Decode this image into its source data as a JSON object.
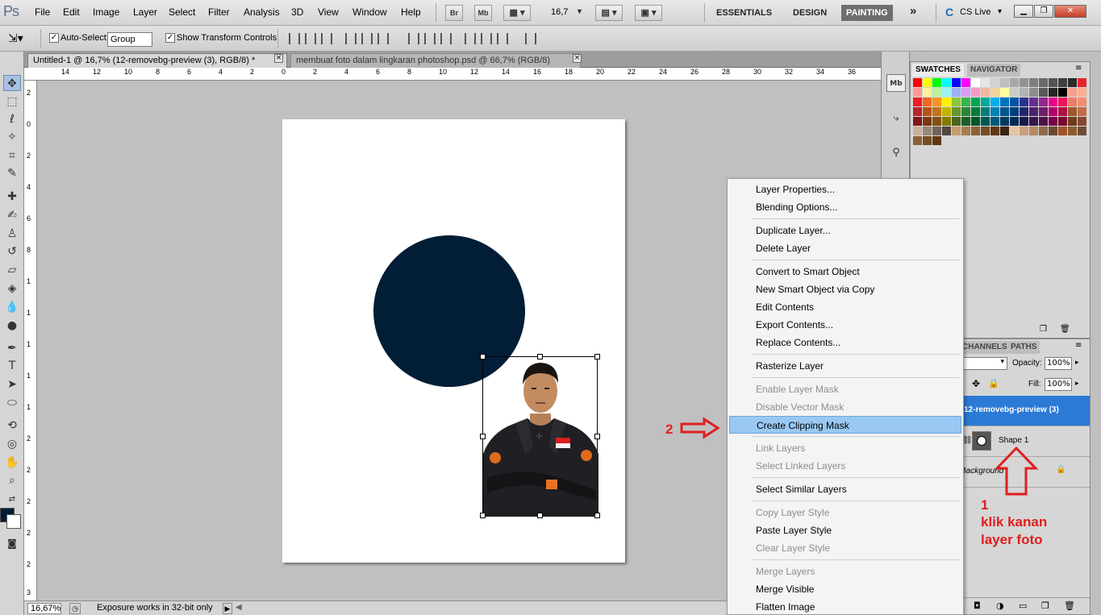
{
  "app": {
    "logo": "Ps"
  },
  "menu": {
    "items": [
      "File",
      "Edit",
      "Image",
      "Layer",
      "Select",
      "Filter",
      "Analysis",
      "3D",
      "View",
      "Window",
      "Help"
    ]
  },
  "app_bar": {
    "bridge": "Br",
    "minibridge": "Mb",
    "zoom": "16,7",
    "workspaces": [
      "ESSENTIALS",
      "DESIGN",
      "PAINTING"
    ],
    "more": "»",
    "cs_live": "CS Live"
  },
  "options": {
    "auto_select_label": "Auto-Select:",
    "auto_select_value": "Group",
    "show_transform_label": "Show Transform Controls",
    "check": "✓"
  },
  "tabs": [
    {
      "label": "Untitled-1 @ 16,7% (12-removebg-preview (3), RGB/8) *",
      "close": "×"
    },
    {
      "label": "membuat foto dalam lingkaran photoshop.psd @ 66,7% (RGB/8)",
      "close": "×"
    }
  ],
  "ruler_h": [
    "14",
    "12",
    "10",
    "8",
    "6",
    "4",
    "2",
    "0",
    "2",
    "4",
    "6",
    "8",
    "10",
    "12",
    "14",
    "16",
    "18",
    "20",
    "22",
    "24",
    "26",
    "28",
    "30",
    "32",
    "34",
    "36"
  ],
  "ruler_v": [
    "2",
    "0",
    "2",
    "4",
    "6",
    "8",
    "1",
    "1",
    "1",
    "1",
    "1",
    "2",
    "2",
    "2",
    "2",
    "2",
    "3"
  ],
  "status": {
    "zoom": "16,67%",
    "info": "Exposure works in 32-bit only"
  },
  "panels": {
    "top_tabs": [
      "SWATCHES",
      "NAVIGATOR"
    ],
    "layer_tabs": [
      "CHANNELS",
      "PATHS"
    ],
    "opacity_label": "Opacity:",
    "opacity_value": "100%",
    "fill_label": "Fill:",
    "fill_value": "100%",
    "layers": [
      {
        "name": "12-removebg-preview (3)"
      },
      {
        "name": "Shape 1"
      },
      {
        "name": "Background"
      }
    ]
  },
  "swatch_colors": [
    [
      "#ff0000",
      "#ffff00",
      "#00ff00",
      "#00ffff",
      "#0000ff",
      "#ff00ff",
      "#ffffff",
      "#e6e6e6",
      "#d2d2d2",
      "#bdbdbd",
      "#a8a8a8",
      "#939393",
      "#7e7e7e",
      "#696969",
      "#545454",
      "#3f3f3f",
      "#2a2a2a",
      "#e8232d"
    ],
    [
      "#ff9999",
      "#f6f29c",
      "#b8f29c",
      "#9cf2f2",
      "#9cb0f2",
      "#d99cf2",
      "#f29cc8",
      "#f2b89c",
      "#f2d39c",
      "#ffff99",
      "#cccccc",
      "#b3b3b3",
      "#8c8c8c",
      "#595959",
      "#262626",
      "#000000",
      "#f5a08c",
      "#f7b08f"
    ],
    [
      "#ed1c24",
      "#f26522",
      "#f7941d",
      "#fff200",
      "#8dc63f",
      "#39b54a",
      "#00a651",
      "#00a99d",
      "#00aeef",
      "#0072bc",
      "#0054a6",
      "#2e3192",
      "#662d91",
      "#92278f",
      "#ec008c",
      "#ed145b",
      "#ea7e68",
      "#f08d70"
    ],
    [
      "#b7252c",
      "#b9521a",
      "#bf7314",
      "#bfb600",
      "#6a962e",
      "#2b8838",
      "#007d3c",
      "#007f76",
      "#0083b4",
      "#00568f",
      "#003f7d",
      "#22256e",
      "#4d226d",
      "#6e1e6b",
      "#b1006a",
      "#b20f44",
      "#a0582a",
      "#c26a4d"
    ],
    [
      "#7d191e",
      "#7e3811",
      "#835010",
      "#837d00",
      "#496620",
      "#1e5e26",
      "#005529",
      "#005752",
      "#005a7b",
      "#003b62",
      "#002b56",
      "#17194b",
      "#34174b",
      "#4b1449",
      "#790049",
      "#7a0b2f",
      "#6e3c1e",
      "#86472f"
    ],
    [
      "#c7b299",
      "#998675",
      "#736357",
      "#534741",
      "#c69c6d",
      "#a67c52",
      "#8c6239",
      "#754c24",
      "#603913",
      "#3c2415",
      "#e4c5a5",
      "#c9a07c",
      "#b58b64",
      "#8f6a4a",
      "#6b4a30",
      "#a0522d",
      "#8b5a2b",
      "#6f4e37"
    ],
    [
      "#8c6239",
      "#754c24",
      "#603913"
    ]
  ],
  "context_menu": {
    "items": [
      {
        "label": "Layer Properties...",
        "state": "enabled"
      },
      {
        "label": "Blending Options...",
        "state": "enabled"
      },
      {
        "label": "Duplicate Layer...",
        "state": "enabled"
      },
      {
        "label": "Delete Layer",
        "state": "enabled"
      },
      {
        "label": "Convert to Smart Object",
        "state": "enabled"
      },
      {
        "label": "New Smart Object via Copy",
        "state": "enabled"
      },
      {
        "label": "Edit Contents",
        "state": "enabled"
      },
      {
        "label": "Export Contents...",
        "state": "enabled"
      },
      {
        "label": "Replace Contents...",
        "state": "enabled"
      },
      {
        "label": "Rasterize Layer",
        "state": "enabled"
      },
      {
        "label": "Enable Layer Mask",
        "state": "disabled"
      },
      {
        "label": "Disable Vector Mask",
        "state": "disabled"
      },
      {
        "label": "Create Clipping Mask",
        "state": "highlight"
      },
      {
        "label": "Link Layers",
        "state": "disabled"
      },
      {
        "label": "Select Linked Layers",
        "state": "disabled"
      },
      {
        "label": "Select Similar Layers",
        "state": "enabled"
      },
      {
        "label": "Copy Layer Style",
        "state": "disabled"
      },
      {
        "label": "Paste Layer Style",
        "state": "enabled"
      },
      {
        "label": "Clear Layer Style",
        "state": "disabled"
      },
      {
        "label": "Merge Layers",
        "state": "disabled"
      },
      {
        "label": "Merge Visible",
        "state": "enabled"
      },
      {
        "label": "Flatten Image",
        "state": "enabled"
      }
    ]
  },
  "annotations": {
    "step2": "2",
    "step1": "1",
    "step1_text_line1": "klik kanan",
    "step1_text_line2": "layer foto"
  },
  "colors": {
    "circle": "#021d36",
    "annotation": "#e01e1e",
    "highlight": "#99c9f2",
    "selected_layer": "#2b7ad6"
  }
}
